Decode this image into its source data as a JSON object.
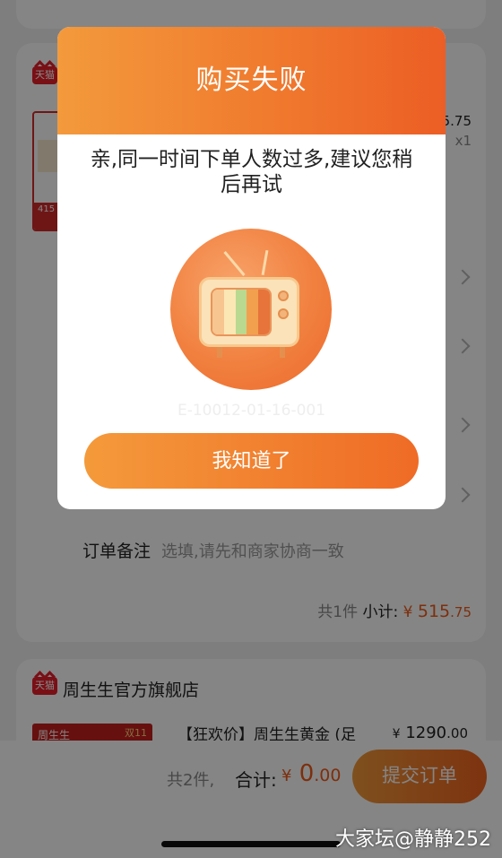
{
  "order_page": {
    "store_badge": "天猫",
    "product_price_partial": "5.75",
    "product_qty": "x1",
    "product_thumb_strip": "415",
    "note_label": "订单备注",
    "note_placeholder": "选填,请先和商家协商一致",
    "subtotal_count": "共1件",
    "subtotal_label": "小计:",
    "subtotal_currency": "¥",
    "subtotal_int": "515",
    "subtotal_dec": ".75",
    "store2_badge": "天猫",
    "store2_name": "周生生官方旗舰店",
    "store2_thumb_text": "周生生",
    "store2_thumb_tag": "双11",
    "store2_product_title": "【狂欢价】周生生黄金 (足",
    "store2_price_cur": "¥",
    "store2_price_int": "1290",
    "store2_price_dec": ".00"
  },
  "bottom_bar": {
    "count": "共2件,",
    "total_label": "合计:",
    "total_currency": "¥",
    "total_int": "0",
    "total_dec": ".00",
    "submit_label": "提交订单"
  },
  "modal": {
    "title": "购买失败",
    "message": "亲,同一时间下单人数过多,建议您稍后再试",
    "code": "E-10012-01-16-001",
    "confirm_label": "我知道了",
    "illustration": "retro-tv-icon",
    "colors": {
      "accent_start": "#f39a3c",
      "accent_end": "#ec5e25"
    }
  },
  "watermark": "大家坛@静静252"
}
